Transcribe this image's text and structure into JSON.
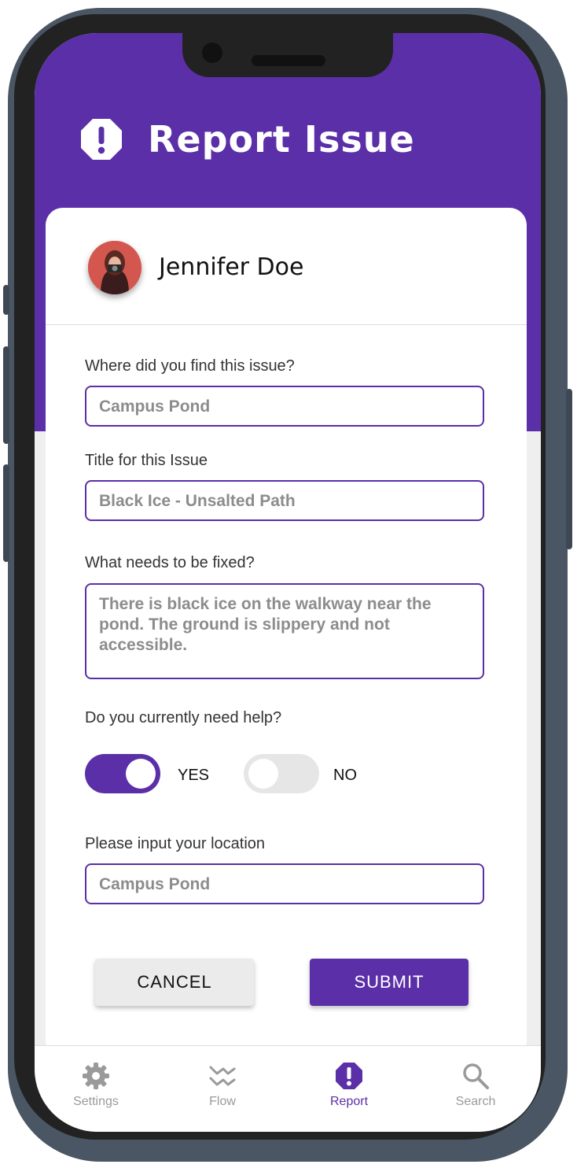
{
  "header": {
    "title": "Report Issue",
    "icon": "alert-octagon-icon"
  },
  "user": {
    "name": "Jennifer Doe",
    "avatar": "avatar"
  },
  "form": {
    "where_label": "Where did you find this issue?",
    "where_value": "Campus Pond",
    "title_label": "Title for this Issue",
    "title_value": "Black Ice - Unsalted Path",
    "fix_label": "What needs to be fixed?",
    "fix_value": "There is black ice on the walkway near the pond. The ground is slippery and not accessible.",
    "help_label": "Do you currently need help?",
    "yes_label": "YES",
    "no_label": "NO",
    "help_yes_on": true,
    "help_no_on": false,
    "location_label": "Please input your location",
    "location_value": "Campus Pond"
  },
  "buttons": {
    "cancel": "CANCEL",
    "submit": "SUBMIT"
  },
  "nav": {
    "items": [
      {
        "label": "Settings",
        "icon": "gear-icon",
        "active": false
      },
      {
        "label": "Flow",
        "icon": "flow-icon",
        "active": false
      },
      {
        "label": "Report",
        "icon": "alert-octagon-icon",
        "active": true
      },
      {
        "label": "Search",
        "icon": "search-icon",
        "active": false
      }
    ]
  },
  "colors": {
    "accent": "#5b2fa8",
    "inactive": "#9a9a9a",
    "toggle_off": "#e6e6e6"
  }
}
